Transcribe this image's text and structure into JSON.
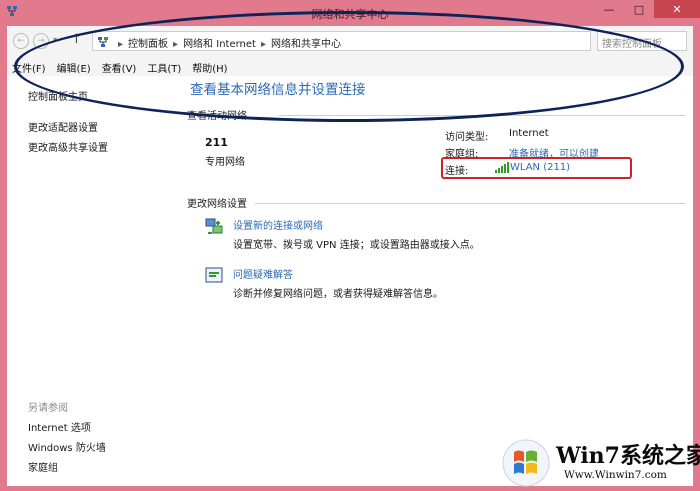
{
  "window": {
    "title": "网络和共享中心",
    "controls": {
      "minimize": "—",
      "maximize": "□",
      "close": "✕"
    }
  },
  "nav": {
    "back_icon": "back-arrow-icon",
    "forward_icon": "forward-arrow-icon",
    "back_glyph": "←",
    "forward_glyph": "→",
    "up_glyph": "↑",
    "dropdown_glyph": "▾"
  },
  "address": {
    "crumbs": [
      "控制面板",
      "网络和 Internet",
      "网络和共享中心"
    ],
    "separator": "▸",
    "dropdown_glyph": "⌄",
    "refresh_glyph": "↻"
  },
  "search": {
    "placeholder": "搜索控制面板"
  },
  "menu": [
    "文件(F)",
    "编辑(E)",
    "查看(V)",
    "工具(T)",
    "帮助(H)"
  ],
  "sidebar": {
    "links": [
      "控制面板主页",
      "更改适配器设置",
      "更改高级共享设置"
    ],
    "see_also_title": "另请参阅",
    "see_also": [
      "Internet 选项",
      "Windows 防火墙",
      "家庭组"
    ]
  },
  "main": {
    "title": "查看基本网络信息并设置连接",
    "active_networks_label": "查看活动网络",
    "network": {
      "name": "211",
      "type": "专用网络",
      "access_type_label": "访问类型:",
      "access_type_value": "Internet",
      "homegroup_label": "家庭组:",
      "homegroup_value": "准备就绪，可以创建",
      "connection_label": "连接:",
      "connection_value": "WLAN (211)"
    },
    "change_settings_label": "更改网络设置",
    "tasks": [
      {
        "title": "设置新的连接或网络",
        "desc": "设置宽带、拨号或 VPN 连接；或设置路由器或接入点。"
      },
      {
        "title": "问题疑难解答",
        "desc": "诊断并修复网络问题，或者获得疑难解答信息。"
      }
    ]
  },
  "annotations": {
    "ellipse_color": "#0e2358",
    "box_color": "#d2202b"
  },
  "colors": {
    "title_bar": "#e07a8c",
    "link": "#2b6ab3",
    "signal": "#2e9a2e"
  },
  "watermark": {
    "title": "Win7系统之家",
    "url": "Www.Winwin7.com"
  }
}
